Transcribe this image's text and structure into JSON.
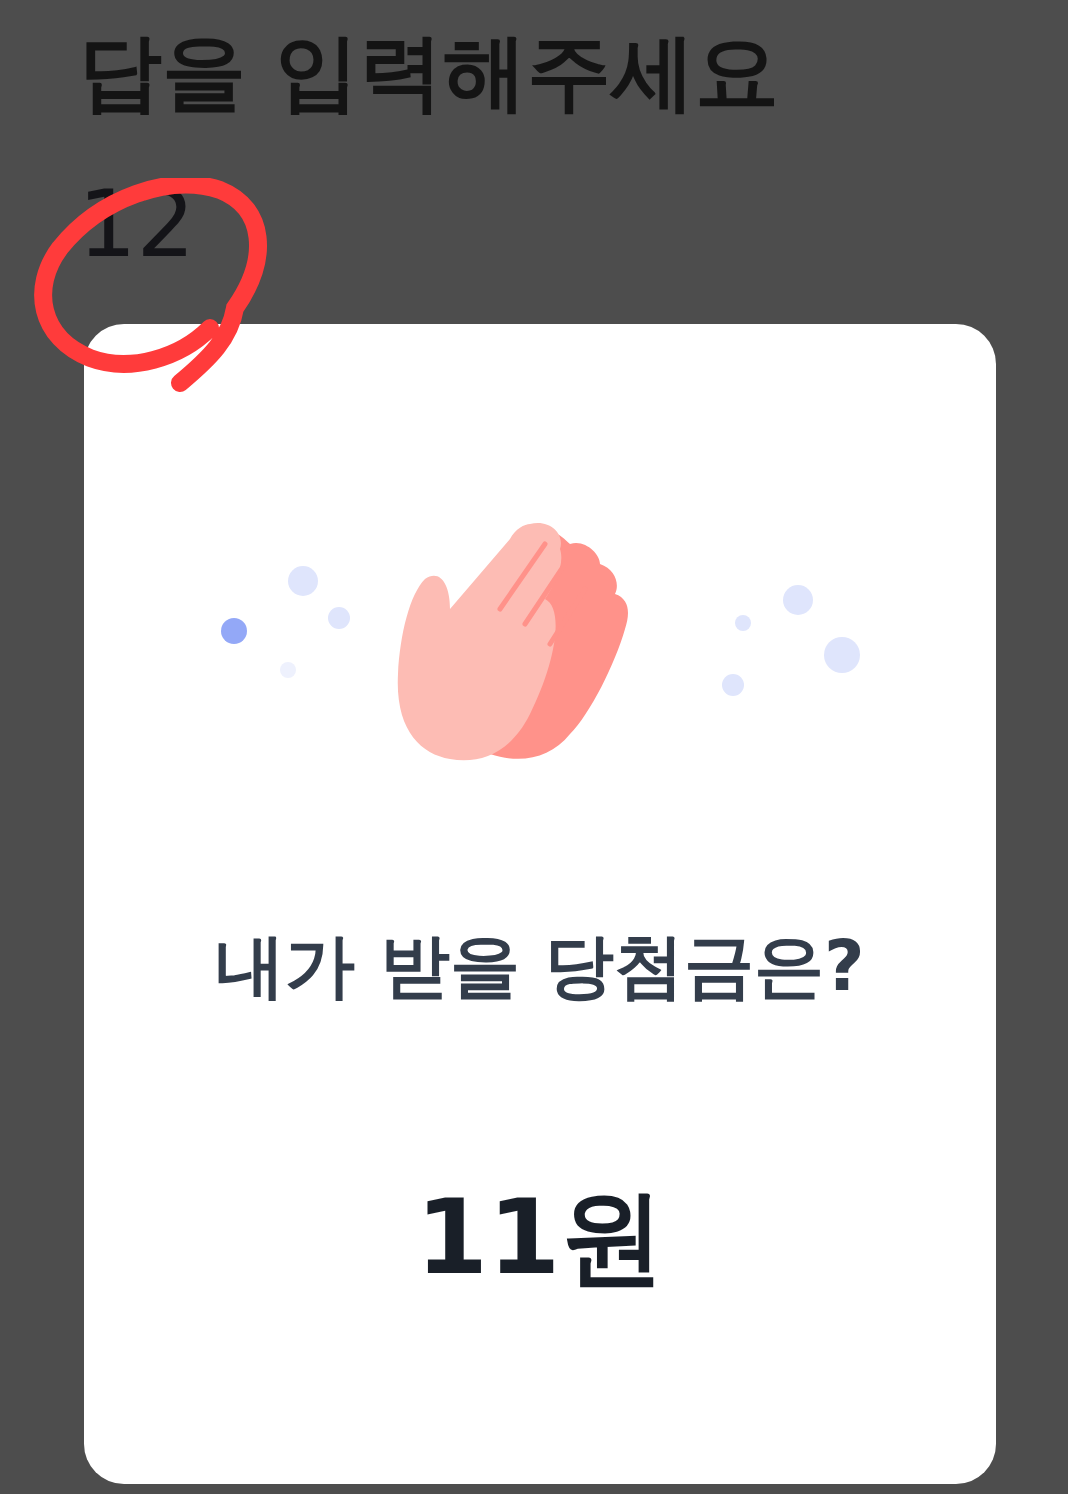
{
  "page": {
    "title": "답을 입력해주세요",
    "answer": "12"
  },
  "dialog": {
    "question": "내가 받을 당첨금은?",
    "prize": "11원"
  }
}
